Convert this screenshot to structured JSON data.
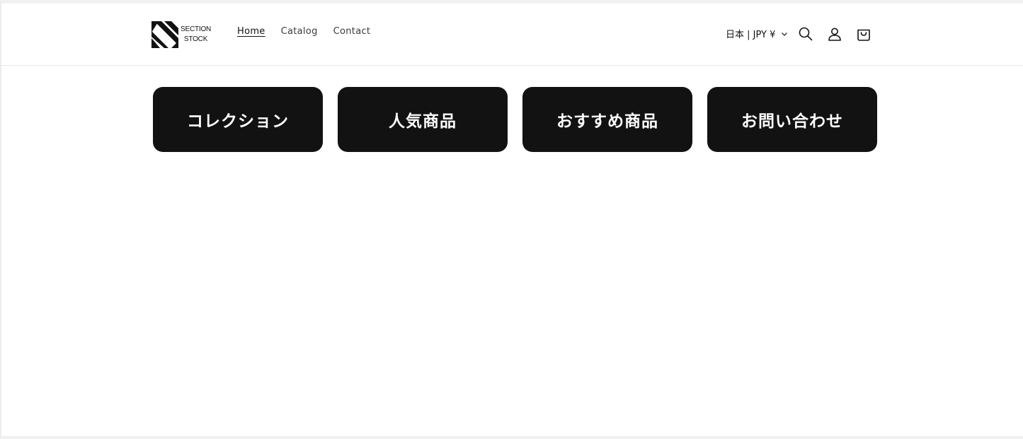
{
  "header": {
    "logo": {
      "line1": "SECTION",
      "line2": "STOCK",
      "icon": "diagonal-stripes-logo"
    },
    "nav": [
      {
        "label": "Home",
        "active": true
      },
      {
        "label": "Catalog",
        "active": false
      },
      {
        "label": "Contact",
        "active": false
      }
    ],
    "currency_label": "日本 | JPY ¥",
    "icons": [
      "chevron-down-icon",
      "search-icon",
      "account-icon",
      "cart-icon"
    ]
  },
  "tiles": [
    {
      "label": "コレクション"
    },
    {
      "label": "人気商品"
    },
    {
      "label": "おすすめ商品"
    },
    {
      "label": "お問い合わせ"
    }
  ],
  "colors": {
    "text": "#121212",
    "tile_bg": "#121212",
    "tile_text": "#ffffff",
    "background": "#ffffff"
  }
}
